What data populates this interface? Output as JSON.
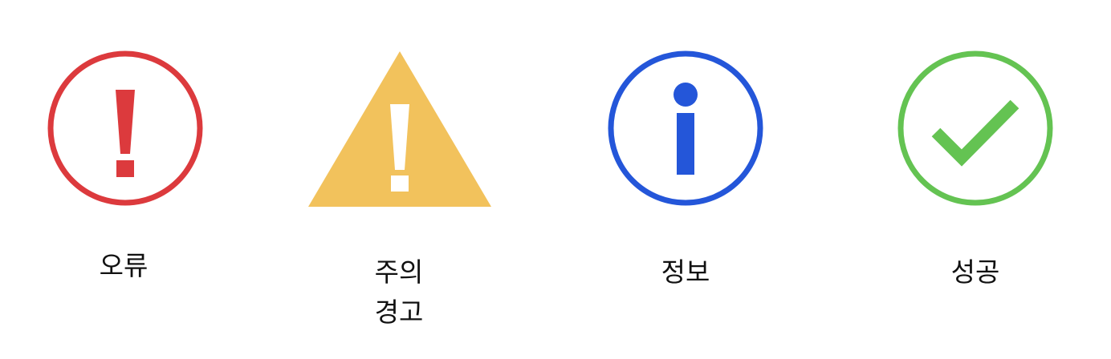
{
  "items": [
    {
      "id": "error",
      "icon": "error-circle-exclamation-icon",
      "color": "#dc3a3d",
      "label_lines": [
        "오류"
      ]
    },
    {
      "id": "warning",
      "icon": "warning-triangle-exclamation-icon",
      "color": "#f2c25c",
      "label_lines": [
        "주의",
        "경고"
      ]
    },
    {
      "id": "info",
      "icon": "info-circle-icon",
      "color": "#2456d9",
      "label_lines": [
        "정보"
      ]
    },
    {
      "id": "success",
      "icon": "success-circle-check-icon",
      "color": "#64c352",
      "label_lines": [
        "성공"
      ]
    }
  ]
}
